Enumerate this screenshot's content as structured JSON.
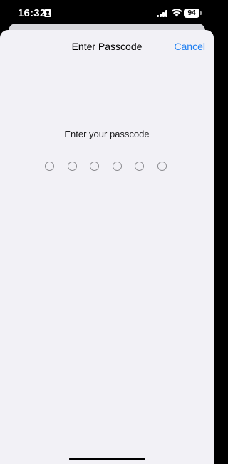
{
  "status_bar": {
    "time": "16:32",
    "battery": "94",
    "icons": [
      "person-badge-icon",
      "cellular-signal-icon",
      "wifi-icon",
      "battery-icon"
    ]
  },
  "sheet": {
    "title": "Enter Passcode",
    "cancel_label": "Cancel",
    "prompt": "Enter your passcode",
    "passcode_length": 6,
    "digits_entered": 0
  },
  "colors": {
    "accent": "#1f7ff1",
    "sheet_background": "#f2f1f6",
    "dot_outline": "#8a8a8e"
  }
}
